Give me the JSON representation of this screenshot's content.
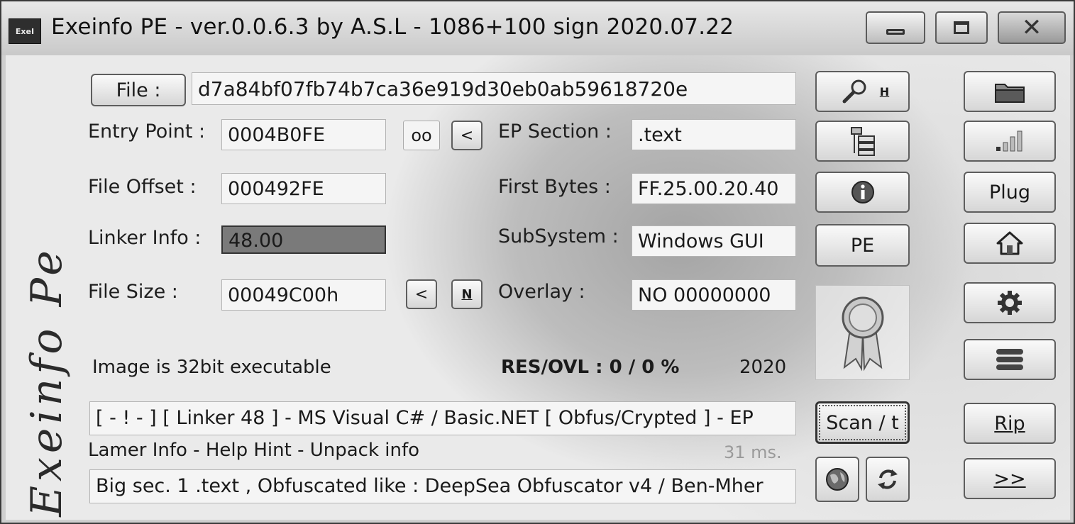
{
  "window": {
    "icon_text": "ExeI",
    "title": "Exeinfo PE - ver.0.0.6.3  by A.S.L -  1086+100 sign  2020.07.22",
    "side_logo": "Exeinfo Pe"
  },
  "file": {
    "button_label": "File :",
    "value": "d7a84bf07fb74b7ca36e919d30eb0ab59618720e"
  },
  "fields": {
    "entry_point_label": "Entry Point :",
    "entry_point_value": "0004B0FE",
    "oo_button": "oo",
    "lt_button": "<",
    "ep_section_label": "EP Section :",
    "ep_section_value": ".text",
    "file_offset_label": "File Offset :",
    "file_offset_value": "000492FE",
    "first_bytes_label": "First Bytes :",
    "first_bytes_value": "FF.25.00.20.40",
    "linker_info_label": "Linker Info :",
    "linker_info_value": "48.00",
    "subsystem_label": "SubSystem :",
    "subsystem_value": "Windows GUI",
    "file_size_label": "File Size :",
    "file_size_value": "00049C00h",
    "size_lt_button": "<",
    "n_button": "N",
    "overlay_label": "Overlay :",
    "overlay_value": "NO   00000000"
  },
  "status": {
    "image_info": "Image is 32bit executable",
    "res_ovl": "RES/OVL : 0 / 0 %",
    "year": "2020",
    "detection": "[ - ! - ] [ Linker 48 ] - MS Visual C# / Basic.NET  [ Obfus/Crypted ]  - EP",
    "lamer_info": "Lamer Info - Help Hint - Unpack info",
    "time": "31 ms.",
    "hint": "Big sec. 1 .text , Obfuscated like :  DeepSea Obfuscator v4 / Ben-Mher"
  },
  "buttons": {
    "h_label": "H",
    "pe_label": "PE",
    "scan_label": "Scan / t",
    "plug_label": "Plug",
    "rip_label": "Rip",
    "next_label": ">>"
  },
  "icons": {
    "search": "magnifier-icon",
    "sections": "sections-tree-icon",
    "info": "info-icon",
    "certificate": "ribbon-badge-icon",
    "globe": "globe-icon",
    "refresh": "refresh-icon",
    "open": "folder-icon",
    "stats": "signal-bars-icon",
    "home": "home-icon",
    "settings": "gear-icon",
    "list": "list-icon"
  }
}
